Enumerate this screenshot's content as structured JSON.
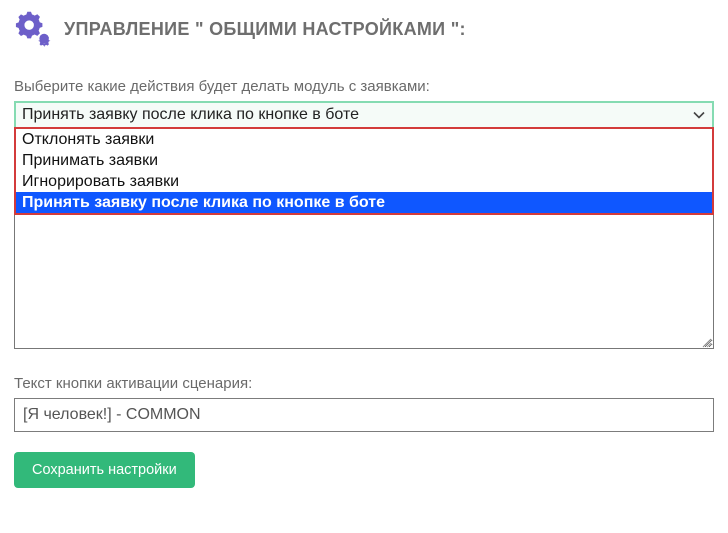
{
  "header": {
    "title": "УПРАВЛЕНИЕ \" ОБЩИМИ НАСТРОЙКАМИ \":"
  },
  "action_select": {
    "label": "Выберите какие действия будет делать модуль с заявками:",
    "selected": "Принять заявку после клика по кнопке в боте",
    "options": [
      "Отклонять заявки",
      "Принимать заявки",
      "Игнорировать заявки",
      "Принять заявку после клика по кнопке в боте"
    ],
    "selected_index": 3
  },
  "button_text": {
    "label": "Текст кнопки активации сценария:",
    "value": "[Я человек!] - COMMON"
  },
  "save_button": {
    "label": "Сохранить настройки"
  },
  "colors": {
    "accent": "#6d5fc9",
    "select_border": "#85dbb2",
    "dropdown_border": "#d33b3b",
    "highlight": "#0f57ff",
    "save": "#32b97a"
  }
}
